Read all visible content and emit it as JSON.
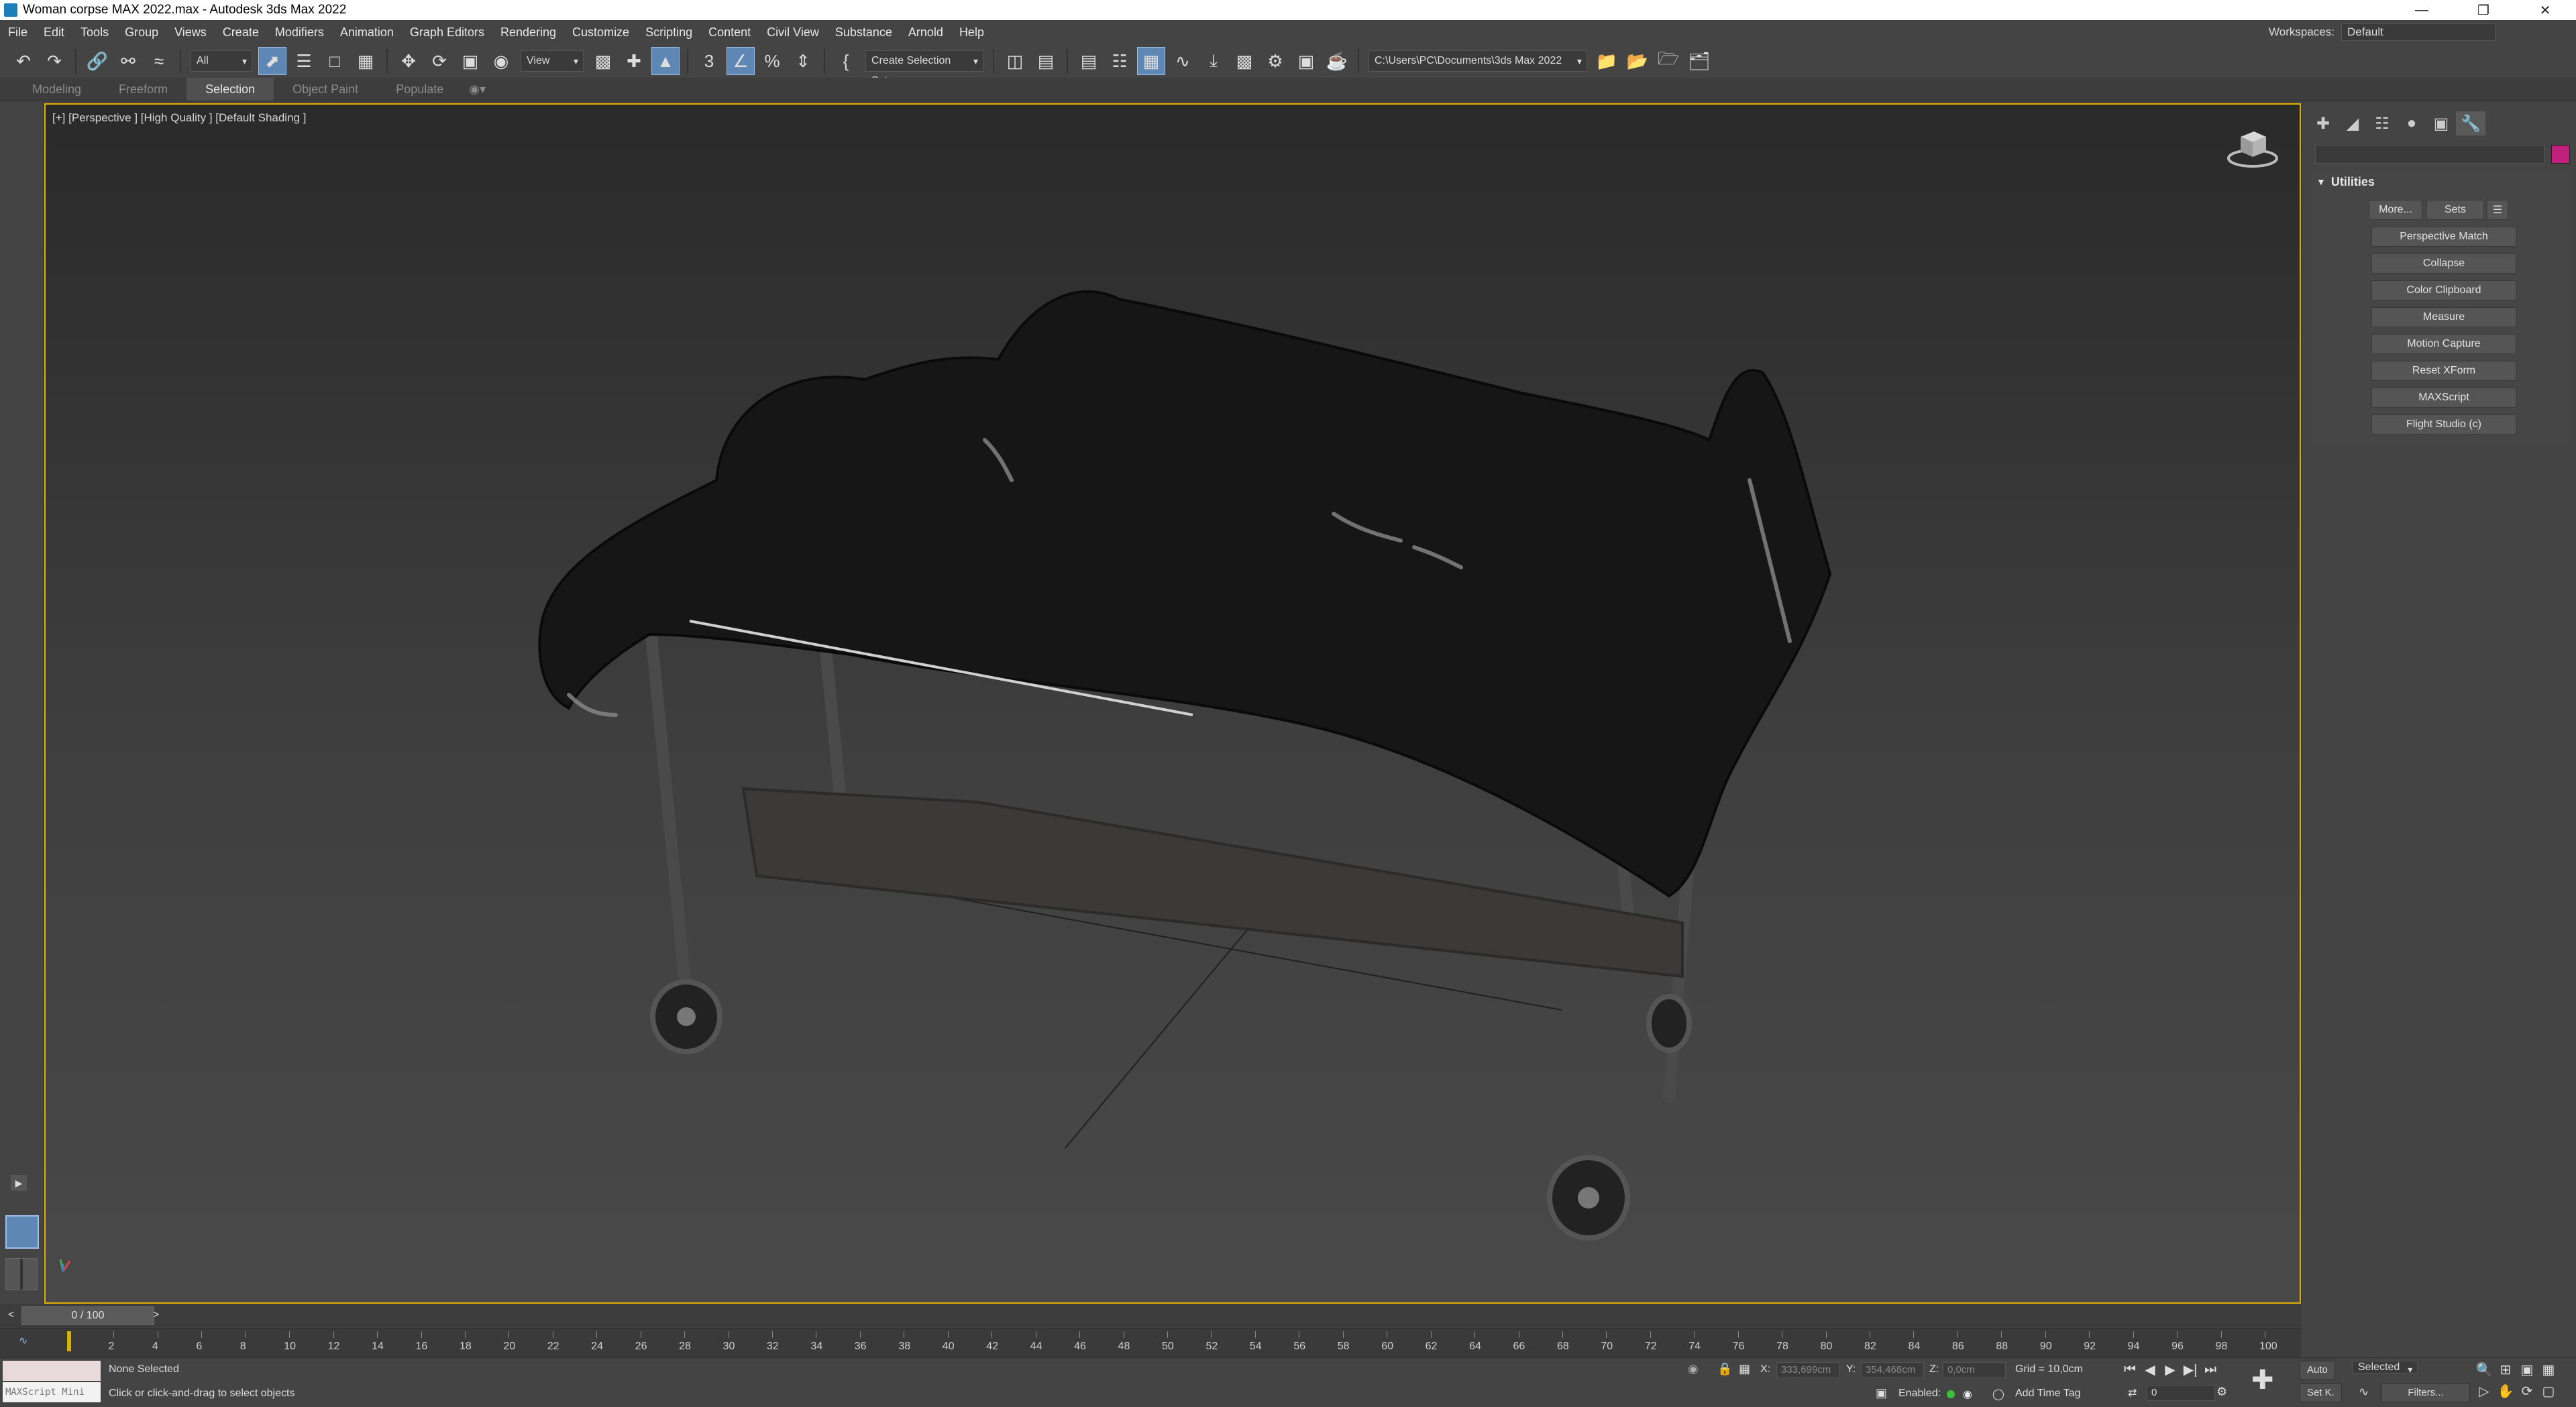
{
  "window": {
    "title": "Woman corpse MAX 2022.max - Autodesk 3ds Max 2022"
  },
  "menu": [
    "File",
    "Edit",
    "Tools",
    "Group",
    "Views",
    "Create",
    "Modifiers",
    "Animation",
    "Graph Editors",
    "Rendering",
    "Customize",
    "Scripting",
    "Content",
    "Civil View",
    "Substance",
    "Arnold",
    "Help"
  ],
  "workspace": {
    "label": "Workspaces:",
    "value": "Default"
  },
  "toolbar": {
    "filter": "All",
    "ref_coord": "View",
    "selection_set_placeholder": "Create Selection Set",
    "project_path": "C:\\Users\\PC\\Documents\\3ds Max 2022"
  },
  "ribbon": {
    "tabs": [
      "Modeling",
      "Freeform",
      "Selection",
      "Object Paint",
      "Populate"
    ],
    "active": "Selection"
  },
  "viewport": {
    "label": "[+] [Perspective ] [High Quality ] [Default Shading ]"
  },
  "command_panel": {
    "rollout_title": "Utilities",
    "top_buttons": [
      "More...",
      "Sets"
    ],
    "utilities": [
      "Perspective Match",
      "Collapse",
      "Color Clipboard",
      "Measure",
      "Motion Capture",
      "Reset XForm",
      "MAXScript",
      "Flight Studio (c)"
    ],
    "object_color": "#c0207a"
  },
  "timeline": {
    "frame_display": "0 / 100",
    "ticks": [
      "2",
      "4",
      "6",
      "8",
      "10",
      "12",
      "14",
      "16",
      "18",
      "20",
      "22",
      "24",
      "26",
      "28",
      "30",
      "32",
      "34",
      "36",
      "38",
      "40",
      "42",
      "44",
      "46",
      "48",
      "50",
      "52",
      "54",
      "56",
      "58",
      "60",
      "62",
      "64",
      "66",
      "68",
      "70",
      "72",
      "74",
      "76",
      "78",
      "80",
      "82",
      "84",
      "86",
      "88",
      "90",
      "92",
      "94",
      "96",
      "98",
      "100"
    ]
  },
  "status": {
    "maxscript_label": "MAXScript Mini",
    "selection": "None Selected",
    "prompt": "Click or click-and-drag to select objects",
    "x_label": "X:",
    "x_value": "333,699cm",
    "y_label": "Y:",
    "y_value": "354,468cm",
    "z_label": "Z:",
    "z_value": "0,0cm",
    "grid": "Grid = 10,0cm",
    "enabled_label": "Enabled:",
    "add_time_tag": "Add Time Tag",
    "auto_key": "Auto",
    "set_key": "Set K.",
    "key_mode": "Selected",
    "filters": "Filters...",
    "current_frame": "0"
  }
}
